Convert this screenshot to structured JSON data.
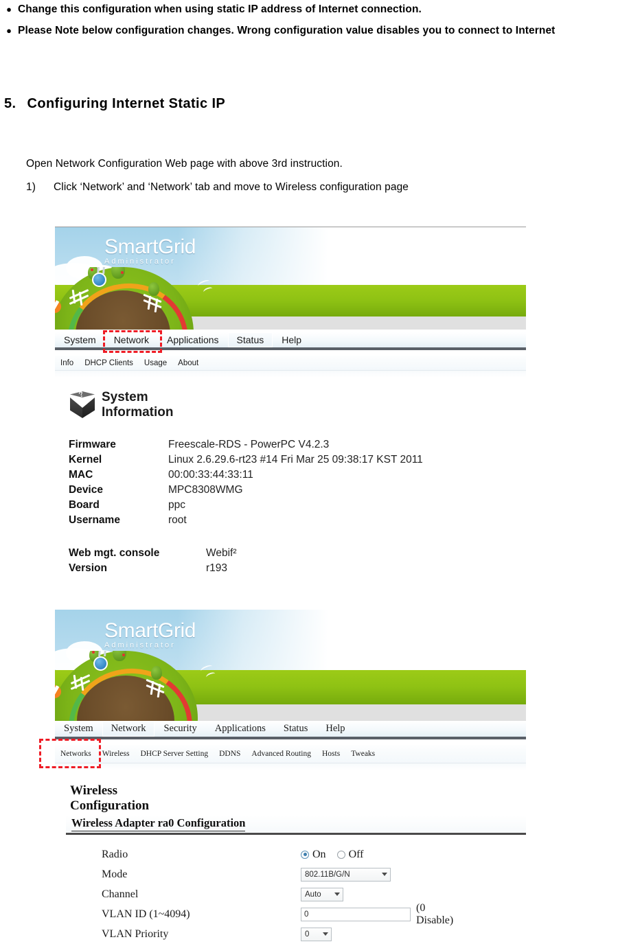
{
  "document": {
    "bullets": [
      "Change this configuration when using static IP address of Internet connection.",
      "Please Note below configuration changes. Wrong configuration value disables you to connect to Internet"
    ],
    "section_number": "5.",
    "section_title": "Configuring Internet Static IP",
    "intro_paragraph": "Open Network Configuration Web page with above 3rd instruction.",
    "step_number": "1)",
    "step_text": "Click ‘Network’ and ‘Network’ tab and move to Wireless configuration page"
  },
  "screenshot1": {
    "banner": {
      "logo_main": "SmartGrid",
      "logo_sub": "Administrator"
    },
    "nav": {
      "items": [
        {
          "label": "System",
          "active": false
        },
        {
          "label": "Network",
          "active": false
        },
        {
          "label": "Applications",
          "active": false
        },
        {
          "label": "Status",
          "active": true
        },
        {
          "label": "Help",
          "active": false
        }
      ],
      "highlighted_item": "Network"
    },
    "subnav": {
      "items": [
        {
          "label": "Info"
        },
        {
          "label": "DHCP Clients"
        },
        {
          "label": "Usage"
        },
        {
          "label": "About"
        }
      ]
    },
    "system_information": {
      "title": "System Information",
      "icon": "cube-question-icon",
      "rows": [
        {
          "key": "Firmware",
          "value": "Freescale-RDS - PowerPC V4.2.3"
        },
        {
          "key": "Kernel",
          "value": "Linux 2.6.29.6-rt23 #14 Fri Mar 25 09:38:17 KST 2011"
        },
        {
          "key": "MAC",
          "value": "00:00:33:44:33:11"
        },
        {
          "key": "Device",
          "value": "MPC8308WMG"
        },
        {
          "key": "Board",
          "value": "ppc"
        },
        {
          "key": "Username",
          "value": "root"
        }
      ],
      "footer_rows": [
        {
          "key": "Web mgt. console",
          "value": "Webif²"
        },
        {
          "key": "Version",
          "value": "r193"
        }
      ]
    }
  },
  "screenshot2": {
    "banner": {
      "logo_main": "SmartGrid",
      "logo_sub": "Administrator"
    },
    "nav": {
      "items": [
        {
          "label": "System",
          "active": false
        },
        {
          "label": "Network",
          "active": true
        },
        {
          "label": "Security",
          "active": false
        },
        {
          "label": "Applications",
          "active": false
        },
        {
          "label": "Status",
          "active": false
        },
        {
          "label": "Help",
          "active": false
        }
      ]
    },
    "subnav": {
      "items": [
        {
          "label": "Networks"
        },
        {
          "label": "Wireless"
        },
        {
          "label": "DHCP Server Setting"
        },
        {
          "label": "DDNS"
        },
        {
          "label": "Advanced Routing"
        },
        {
          "label": "Hosts"
        },
        {
          "label": "Tweaks"
        }
      ],
      "highlighted_item": "Networks"
    },
    "wireless": {
      "page_title": "Wireless Configuration",
      "panel_title": "Wireless Adapter ra0 Configuration",
      "fields": {
        "radio": {
          "label": "Radio",
          "options": [
            {
              "label": "On",
              "selected": true
            },
            {
              "label": "Off",
              "selected": false
            }
          ]
        },
        "mode": {
          "label": "Mode",
          "value": "802.11B/G/N"
        },
        "channel": {
          "label": "Channel",
          "value": "Auto"
        },
        "vlan_id": {
          "label": "VLAN ID (1~4094)",
          "value": "0",
          "hint": "(0 Disable)"
        },
        "vlan_priority": {
          "label": "VLAN Priority",
          "value": "0"
        }
      }
    }
  },
  "colors": {
    "highlight_red": "#ee1c25",
    "banner_green": "#8fc214",
    "banner_sky": "#a5d3ea",
    "nav_rule": "#5a6068"
  }
}
